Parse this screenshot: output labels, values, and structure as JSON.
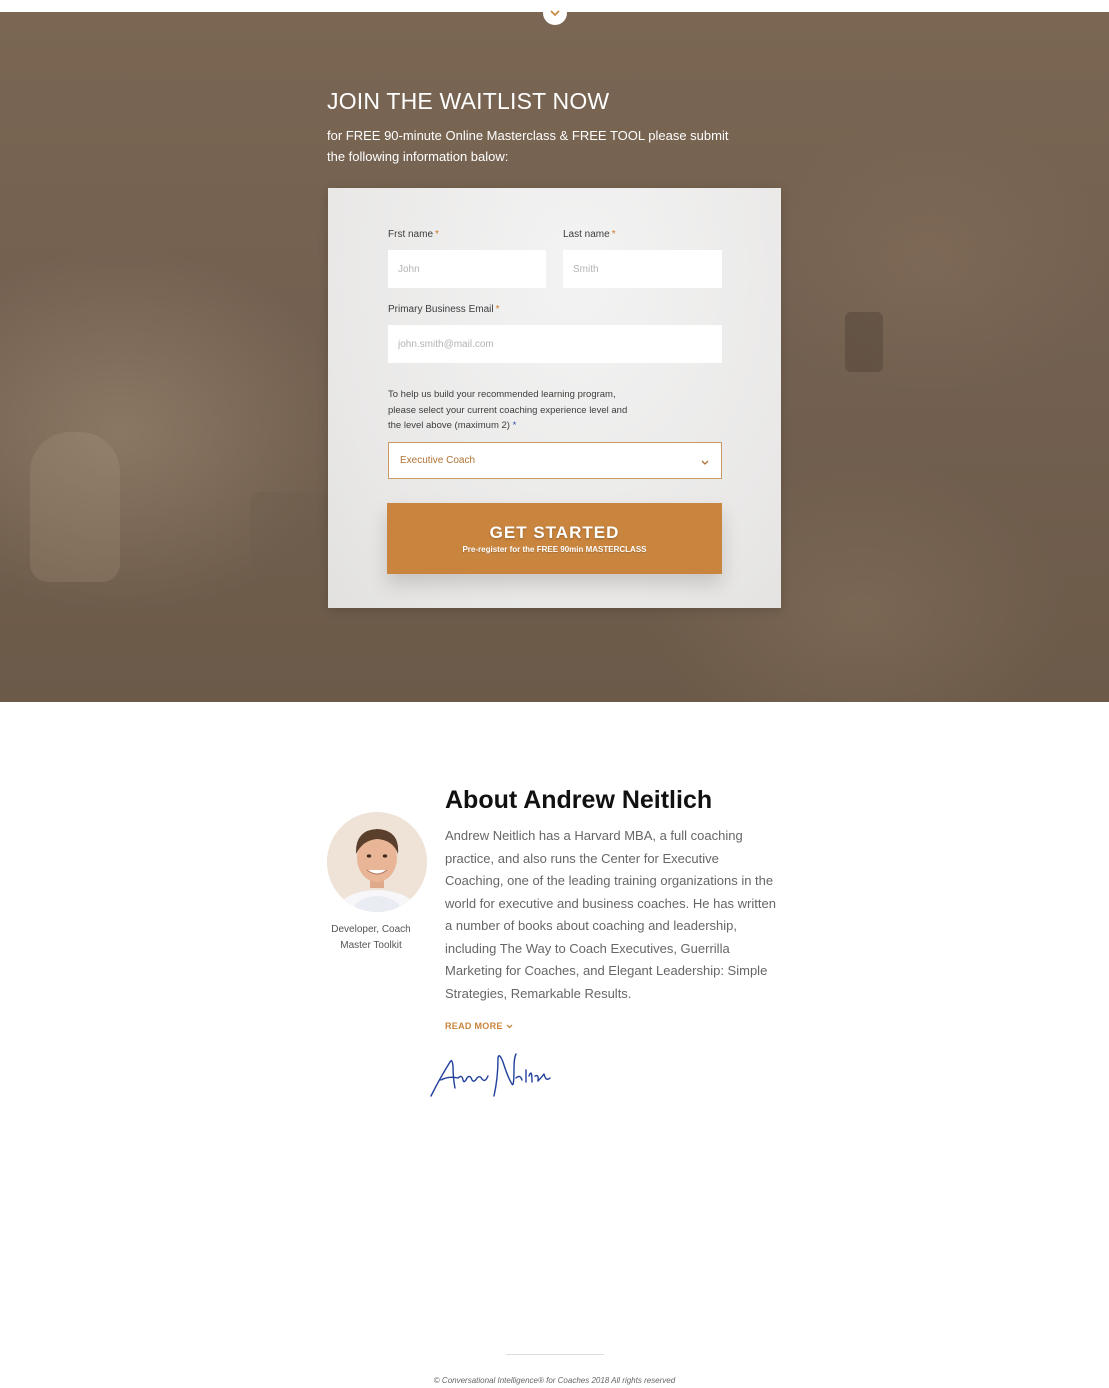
{
  "hero": {
    "title": "JOIN THE WAITLIST NOW",
    "subtitle": "for FREE 90-minute Online Masterclass & FREE TOOL please submit the following information balow:"
  },
  "form": {
    "first_name": {
      "label": "Frst name",
      "required_mark": "*",
      "placeholder": "John"
    },
    "last_name": {
      "label": "Last name",
      "required_mark": "*",
      "placeholder": "Smith"
    },
    "email": {
      "label": "Primary Business Email",
      "required_mark": "*",
      "placeholder": "john.smith@mail.com"
    },
    "level_help": "To help us build your recommended learning program, please select your current coaching experience level and the level above (maximum 2)",
    "level_required_mark": "*",
    "level_select": {
      "value": "Executive Coach"
    },
    "submit": {
      "label": "GET STARTED",
      "sublabel": "Pre-register for the FREE 90min MASTERCLASS"
    }
  },
  "about": {
    "title": "About Andrew Neitlich",
    "body": "Andrew Neitlich has a Harvard MBA, a full coaching practice, and also runs the Center for Executive Coaching, one of the leading training organizations in the world for executive and business coaches. He has written a number of books about coaching and leadership, including The Way to Coach Executives, Guerrilla Marketing for Coaches, and Elegant Leadership: Simple Strategies, Remarkable Results.",
    "caption": "Developer, Coach Master Toolkit",
    "read_more": "READ MORE",
    "signature": "Andrew Neitlich"
  },
  "footer": {
    "copyright": "© Conversational Intelligence® for Coaches 2018  All rights reserved"
  },
  "colors": {
    "accent": "#c9853e",
    "hero_overlay": "#736050",
    "signature_ink": "#1f3f9a"
  },
  "icons": {
    "scroll": "chevron-down-icon",
    "select": "chevron-down-icon",
    "read_more": "chevron-down-icon"
  }
}
